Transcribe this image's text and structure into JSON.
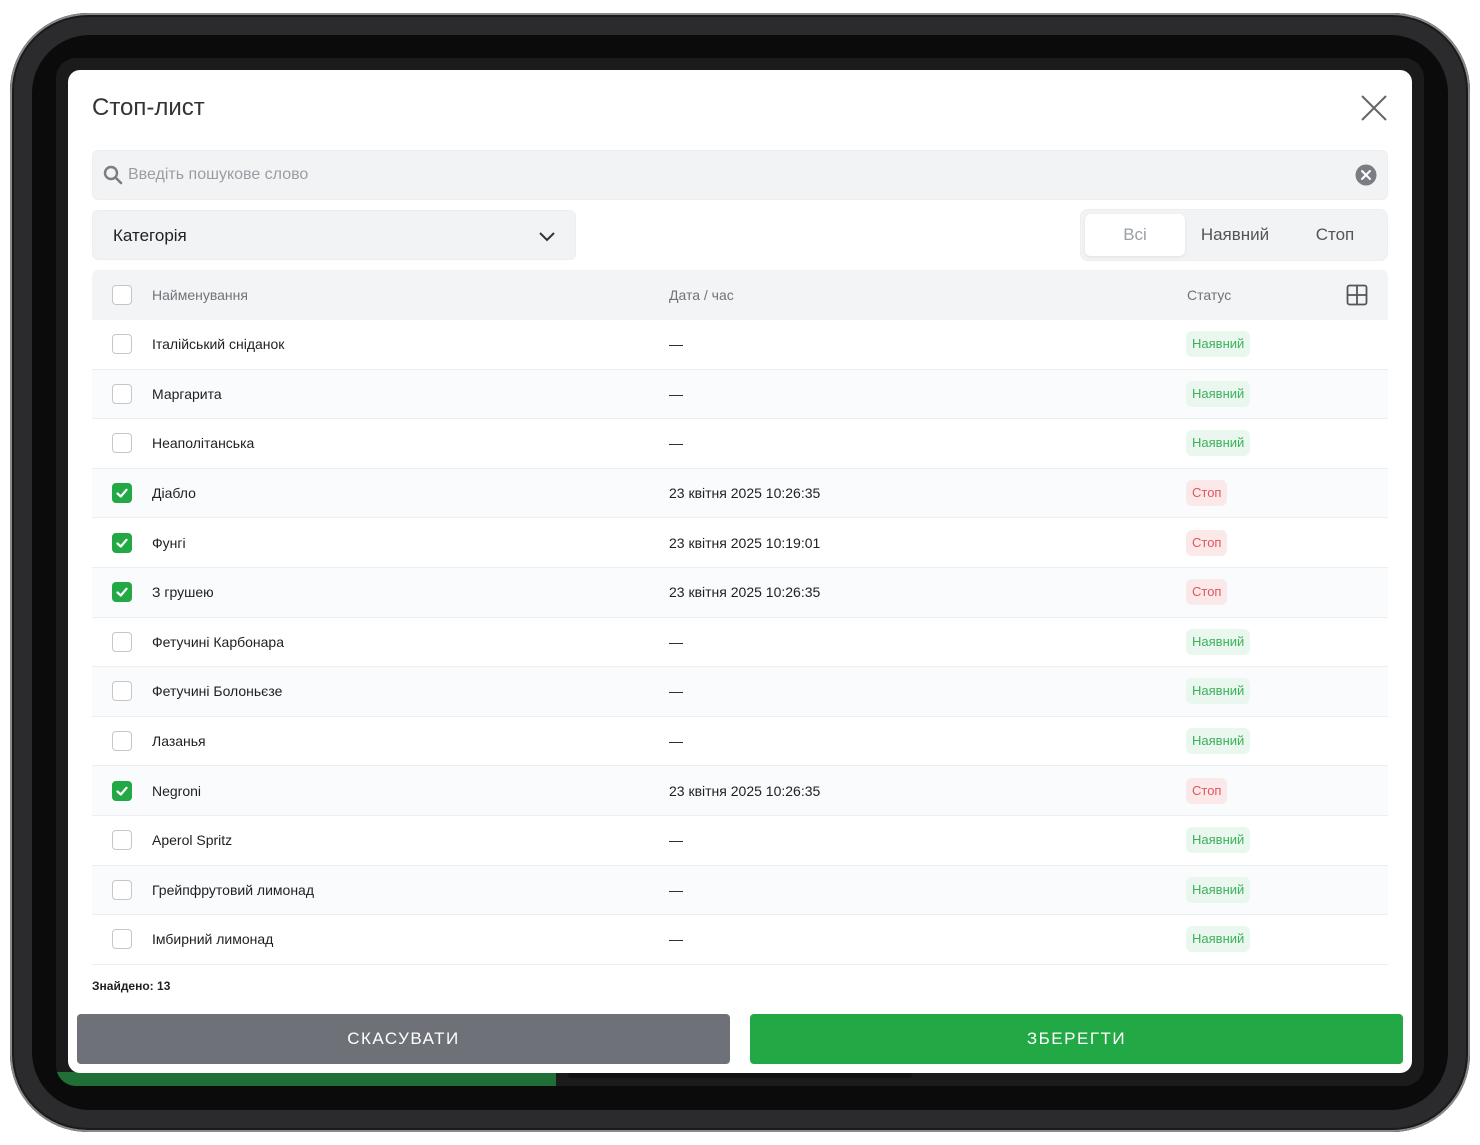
{
  "modal": {
    "title": "Стоп-лист",
    "search_placeholder": "Введіть пошукове слово",
    "category_label": "Категорія",
    "filters": [
      {
        "label": "Всі",
        "active": true
      },
      {
        "label": "Наявний",
        "active": false
      },
      {
        "label": "Стоп",
        "active": false
      }
    ],
    "columns": {
      "name": "Найменування",
      "datetime": "Дата / час",
      "status": "Статус"
    },
    "rows": [
      {
        "name": "Італійський сніданок",
        "datetime": "—",
        "status": "Наявний",
        "checked": false
      },
      {
        "name": "Маргарита",
        "datetime": "—",
        "status": "Наявний",
        "checked": false
      },
      {
        "name": "Неаполітанська",
        "datetime": "—",
        "status": "Наявний",
        "checked": false
      },
      {
        "name": "Діабло",
        "datetime": "23 квітня 2025 10:26:35",
        "status": "Стоп",
        "checked": true
      },
      {
        "name": "Фунгі",
        "datetime": "23 квітня 2025 10:19:01",
        "status": "Стоп",
        "checked": true
      },
      {
        "name": "З грушею",
        "datetime": "23 квітня 2025 10:26:35",
        "status": "Стоп",
        "checked": true
      },
      {
        "name": "Фетучині Карбонара",
        "datetime": "—",
        "status": "Наявний",
        "checked": false
      },
      {
        "name": "Фетучині Болоньєзе",
        "datetime": "—",
        "status": "Наявний",
        "checked": false
      },
      {
        "name": "Лазанья",
        "datetime": "—",
        "status": "Наявний",
        "checked": false
      },
      {
        "name": "Negroni",
        "datetime": "23 квітня 2025 10:26:35",
        "status": "Стоп",
        "checked": true
      },
      {
        "name": "Aperol Spritz",
        "datetime": "—",
        "status": "Наявний",
        "checked": false
      },
      {
        "name": "Грейпфрутовий лимонад",
        "datetime": "—",
        "status": "Наявний",
        "checked": false
      },
      {
        "name": "Імбирний лимонад",
        "datetime": "—",
        "status": "Наявний",
        "checked": false
      }
    ],
    "found_text": "Знайдено: 13",
    "cancel_label": "СКАСУВАТИ",
    "save_label": "ЗБЕРЕГТИ"
  },
  "colors": {
    "accent_green": "#22a845",
    "available_text": "#3cb15c",
    "stop_text": "#e0555d",
    "cancel_gray": "#6e7177"
  },
  "icons": [
    "search-icon",
    "clear-icon",
    "close-icon",
    "chevron-down-icon",
    "grid-icon",
    "check-icon"
  ]
}
